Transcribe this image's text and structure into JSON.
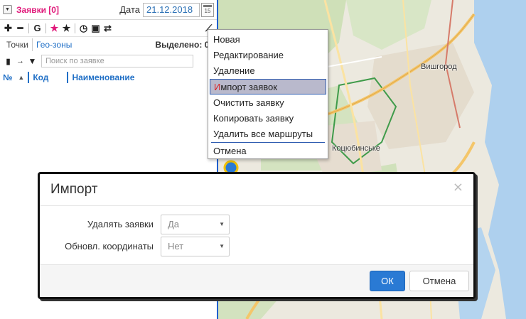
{
  "panel": {
    "title": "Заявки [0]",
    "date_label": "Дата",
    "date_value": "21.12.2018",
    "calendar_day": "15",
    "toolbar": {
      "g_label": "G"
    },
    "tabs": {
      "points": "Точки",
      "geozones": "Гео-зоны"
    },
    "selected_text": "Выделено: 0 /",
    "search": {
      "placeholder": "Поиск по заявке"
    },
    "table": {
      "columns": [
        "№",
        "Код",
        "Наименование"
      ]
    }
  },
  "context_menu": {
    "items": [
      "Новая",
      "Редактирование",
      "Удаление",
      "Импорт заявок",
      "Очистить заявку",
      "Копировать заявку",
      "Удалить все маршруты",
      "Отмена"
    ],
    "highlighted_first_letter": "И",
    "highlighted_rest": "мпорт заявок"
  },
  "map": {
    "labels": {
      "vyshgorod": "Вишгород",
      "kotsiubynske": "Коцюбинське"
    }
  },
  "dialog": {
    "title": "Импорт",
    "close": "×",
    "fields": [
      {
        "label": "Удалять заявки",
        "value": "Да"
      },
      {
        "label": "Обновл. координаты",
        "value": "Нет"
      }
    ],
    "ok_label": "ОК",
    "cancel_label": "Отмена"
  },
  "colors": {
    "accent": "#2a7ad4",
    "title_pink": "#e0197a",
    "link_blue": "#1f6fc6"
  }
}
